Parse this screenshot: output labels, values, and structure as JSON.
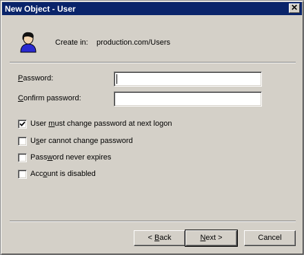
{
  "window": {
    "title": "New Object - User",
    "close_glyph": "✕"
  },
  "header": {
    "avatar_icon": "user-icon",
    "create_in_label": "Create in:",
    "create_in_path": "production.com/Users"
  },
  "fields": [
    {
      "label": "Password:",
      "value": ""
    },
    {
      "label": "Confirm password:",
      "value": ""
    }
  ],
  "options": [
    {
      "label": "User must change password at next logon",
      "checked": true
    },
    {
      "label": "User cannot change password",
      "checked": false
    },
    {
      "label": "Password never expires",
      "checked": false
    },
    {
      "label": "Account is disabled",
      "checked": false
    }
  ],
  "buttons": {
    "back": "< Back",
    "next": "Next >",
    "cancel": "Cancel"
  }
}
